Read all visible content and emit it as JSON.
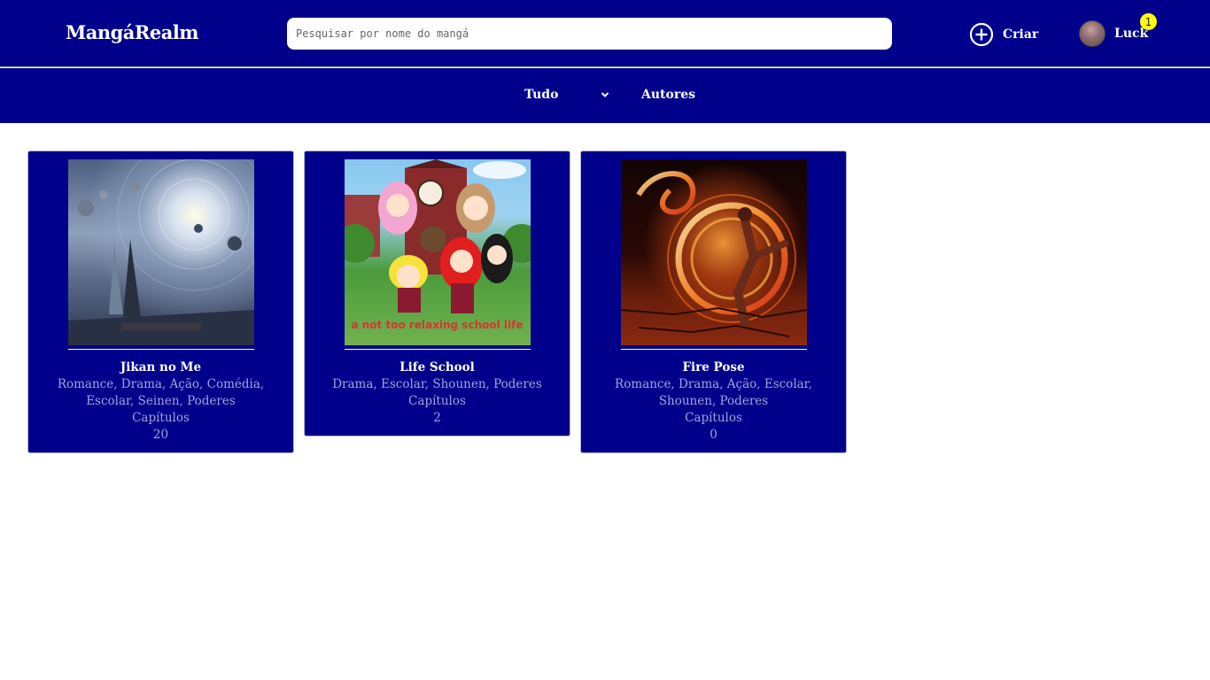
{
  "header": {
    "brand": "MangáRealm",
    "search_placeholder": "Pesquisar por nome do mangá",
    "create_label": "Criar",
    "user_name": "Luck",
    "notification_count": "1"
  },
  "nav": {
    "filter_selected": "Tudo",
    "authors_label": "Autores"
  },
  "cards": [
    {
      "title": "Jikan no Me",
      "genres": "Romance, Drama, Ação, Comédia, Escolar, Seinen, Poderes",
      "chapters_label": "Capítulos",
      "chapters": "20"
    },
    {
      "title": "Life School",
      "genres": "Drama, Escolar, Shounen, Poderes",
      "chapters_label": "Capítulos",
      "chapters": "2",
      "cover_caption": "a not too relaxing school life"
    },
    {
      "title": "Fire Pose",
      "genres": "Romance, Drama, Ação, Escolar, Shounen, Poderes",
      "chapters_label": "Capítulos",
      "chapters": "0"
    }
  ],
  "colors": {
    "brand_blue": "#00008b",
    "muted_text": "#a2a2dc",
    "badge": "#ffff00"
  },
  "icons": {
    "create": "plus-circle-icon",
    "filter": "chevron-down-icon"
  }
}
